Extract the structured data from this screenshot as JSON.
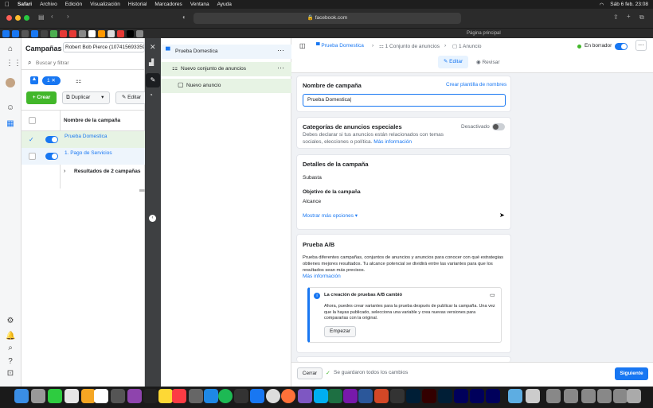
{
  "menubar": {
    "app": "Safari",
    "items": [
      "Archivo",
      "Edición",
      "Visualización",
      "Historial",
      "Marcadores",
      "Ventana",
      "Ayuda"
    ],
    "clock": "Sáb 6 feb.  23:08"
  },
  "browser": {
    "url": "facebook.com",
    "page_label": "Página principal"
  },
  "campaigns": {
    "title": "Campañas",
    "account": "Robert Bob Pierce (107415693359",
    "search_placeholder": "Buscar y filtrar",
    "filter_count": "1",
    "create": "Crear",
    "duplicate": "Duplicar",
    "edit": "Editar",
    "col_name": "Nombre de la campaña",
    "rows": [
      "Prueba Domestica",
      "1. Pago de Servicios"
    ],
    "results": "Resultados de 2 campañas"
  },
  "tree": {
    "campaign": "Prueba Domestica",
    "adset": "Nuevo conjunto de anuncios",
    "ad": "Nuevo anuncio"
  },
  "editor": {
    "breadcrumb": {
      "campaign": "Prueba Domestica",
      "adsets": "1 Conjunto de anuncios",
      "ads": "1 Anuncio"
    },
    "status": "En borrador",
    "tab_edit": "Editar",
    "tab_review": "Revisar",
    "name_section": {
      "title": "Nombre de campaña",
      "template_link": "Crear plantilla de nombres",
      "value": "Prueba Domestica"
    },
    "special": {
      "title": "Categorías de anuncios especiales",
      "state": "Desactivado",
      "desc": "Debes declarar si tus anuncios están relacionados con temas sociales, elecciones o política.",
      "more": "Más información"
    },
    "details": {
      "title": "Detalles de la campaña",
      "buying": "Subasta",
      "objective_label": "Objetivo de la campaña",
      "objective": "Alcance",
      "more_options": "Mostrar más opciones"
    },
    "ab": {
      "title": "Prueba A/B",
      "desc": "Prueba diferentes campañas, conjuntos de anuncios y anuncios para conocer con qué estrategias obtienes mejores resultados. Tu alcance potencial se dividirá entre las variantes para que los resultados sean más precisos.",
      "more": "Más información",
      "notice_title": "La creación de pruebas A/B cambió",
      "notice_body": "Ahora, puedes crear variantes para la prueba después de publicar la campaña. Una vez que la hayas publicado, selecciona una variable y crea nuevas versiones para compararlas con la original.",
      "start": "Empezar"
    },
    "footer": {
      "close": "Cerrar",
      "saved": "Se guardaron todos los cambios",
      "next": "Siguiente"
    }
  },
  "colors": {
    "accent": "#1877f2",
    "green": "#42b72a"
  }
}
